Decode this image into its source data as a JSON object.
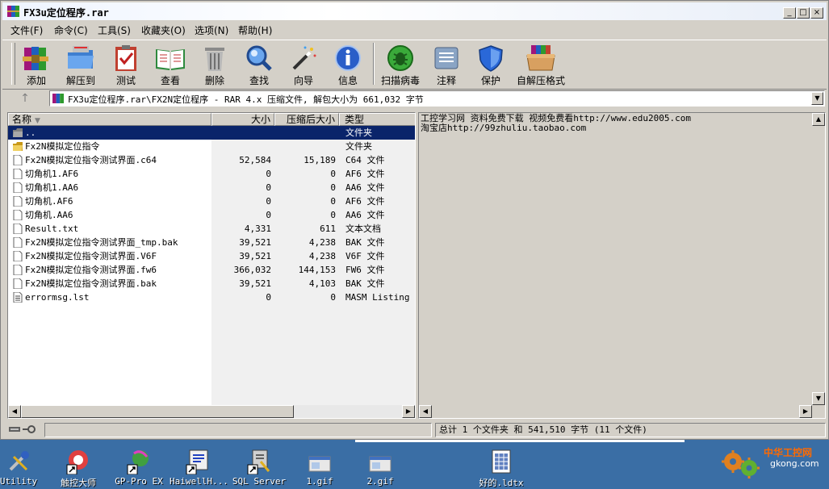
{
  "window": {
    "title": "FX3u定位程序.rar",
    "min_glyph": "_",
    "max_glyph": "□",
    "close_glyph": "×"
  },
  "menu": [
    "文件(F)",
    "命令(C)",
    "工具(S)",
    "收藏夹(O)",
    "选项(N)",
    "帮助(H)"
  ],
  "toolbar": [
    {
      "label": "添加",
      "icon": "rar-books-icon"
    },
    {
      "label": "解压到",
      "icon": "folder-extract-icon"
    },
    {
      "label": "测试",
      "icon": "clipboard-check-icon"
    },
    {
      "label": "查看",
      "icon": "open-book-icon"
    },
    {
      "label": "删除",
      "icon": "trash-can-icon"
    },
    {
      "label": "查找",
      "icon": "magnifier-icon"
    },
    {
      "label": "向导",
      "icon": "magic-wand-icon"
    },
    {
      "label": "信息",
      "icon": "info-icon"
    },
    {
      "label": "扫描病毒",
      "icon": "bug-scan-icon"
    },
    {
      "label": "注释",
      "icon": "comment-icon"
    },
    {
      "label": "保护",
      "icon": "shield-icon"
    },
    {
      "label": "自解压格式",
      "icon": "sfx-box-icon"
    }
  ],
  "address": {
    "up_glyph": "↑",
    "path": "FX3u定位程序.rar\\FX2N定位程序 - RAR 4.x 压缩文件, 解包大小为 661,032 字节"
  },
  "columns": {
    "name": "名称",
    "size": "大小",
    "packed": "压缩后大小",
    "type": "类型"
  },
  "files": [
    {
      "name": "..",
      "size": "",
      "packed": "",
      "type": "文件夹",
      "kind": "parent",
      "selected": true
    },
    {
      "name": "Fx2N模拟定位指令",
      "size": "",
      "packed": "",
      "type": "文件夹",
      "kind": "folder"
    },
    {
      "name": "Fx2N模拟定位指令测试界面.c64",
      "size": "52,584",
      "packed": "15,189",
      "type": "C64 文件",
      "kind": "file"
    },
    {
      "name": "切角机1.AF6",
      "size": "0",
      "packed": "0",
      "type": "AF6 文件",
      "kind": "file"
    },
    {
      "name": "切角机1.AA6",
      "size": "0",
      "packed": "0",
      "type": "AA6 文件",
      "kind": "file"
    },
    {
      "name": "切角机.AF6",
      "size": "0",
      "packed": "0",
      "type": "AF6 文件",
      "kind": "file"
    },
    {
      "name": "切角机.AA6",
      "size": "0",
      "packed": "0",
      "type": "AA6 文件",
      "kind": "file"
    },
    {
      "name": "Result.txt",
      "size": "4,331",
      "packed": "611",
      "type": "文本文档",
      "kind": "file"
    },
    {
      "name": "Fx2N模拟定位指令测试界面_tmp.bak",
      "size": "39,521",
      "packed": "4,238",
      "type": "BAK 文件",
      "kind": "file"
    },
    {
      "name": "Fx2N模拟定位指令测试界面.V6F",
      "size": "39,521",
      "packed": "4,238",
      "type": "V6F 文件",
      "kind": "file"
    },
    {
      "name": "Fx2N模拟定位指令测试界面.fw6",
      "size": "366,032",
      "packed": "144,153",
      "type": "FW6 文件",
      "kind": "file"
    },
    {
      "name": "Fx2N模拟定位指令测试界面.bak",
      "size": "39,521",
      "packed": "4,103",
      "type": "BAK 文件",
      "kind": "file"
    },
    {
      "name": "errormsg.lst",
      "size": "0",
      "packed": "0",
      "type": "MASM Listing",
      "kind": "textfile"
    }
  ],
  "comment": "工控学习网 资料免费下载 视频免费看http://www.edu2005.com\n淘宝店http://99zhuliu.taobao.com",
  "status": {
    "total": "总计 1 个文件夹 和 541,510 字节 (11 个文件)"
  },
  "desktop": [
    {
      "label": "Utility",
      "icon": "utility-icon"
    },
    {
      "label": "触控大师",
      "icon": "touch-master-icon"
    },
    {
      "label": "GP-Pro EX",
      "icon": "gp-pro-icon"
    },
    {
      "label": "HaiwellH...",
      "icon": "haiwell-icon"
    },
    {
      "label": "SQL Server",
      "icon": "sql-server-icon"
    },
    {
      "label": "1.gif",
      "icon": "gif-file-icon"
    },
    {
      "label": "2.gif",
      "icon": "gif-file-icon"
    },
    {
      "label": "好的.ldtx",
      "icon": "ldtx-file-icon"
    }
  ],
  "watermark": {
    "text1": "中华工控网",
    "text2": "gkong.com"
  }
}
